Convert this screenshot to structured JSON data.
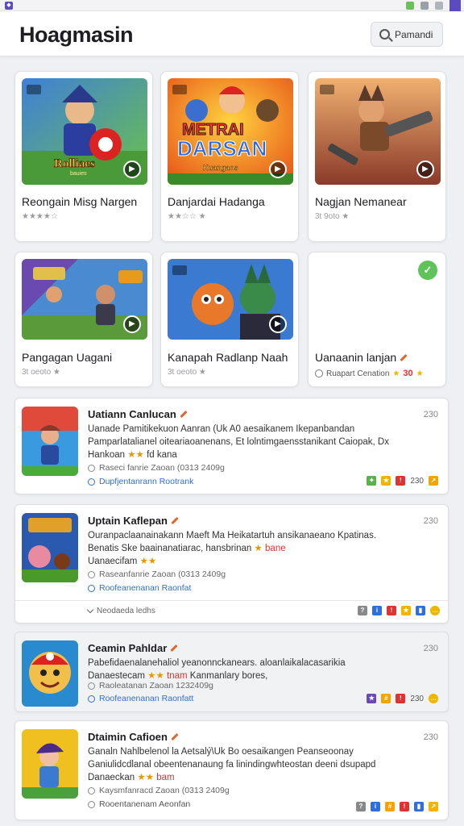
{
  "app": {
    "title": "Hoagmasin"
  },
  "search": {
    "label": "Pamandi"
  },
  "colors": {
    "accent": "#2f6fd6",
    "star": "#f2b400",
    "check": "#5ec45a",
    "pencil": "#e0672f"
  },
  "cards": [
    {
      "title": "Reongain Misg Nargen",
      "meta": "★★★★☆",
      "art_label": "Rolliaes",
      "art_sub": "bauies"
    },
    {
      "title": "Danjardai Hadanga",
      "meta": "★★☆☆ ★",
      "art_label": "METRAI\nDARSAN",
      "art_sub": "Kuangaos"
    },
    {
      "title": "Nagjan Nemanear",
      "meta": "3t 9oto ★"
    },
    {
      "title": "Pangagan Uagani",
      "meta": "3t oeoto ★"
    },
    {
      "title": "Kanapah Radlanp Naah",
      "meta": "3t oeoto ★"
    },
    {
      "title": "Uanaanin lanjan",
      "foot_text": "Ruapart Cenation",
      "foot_num": "30"
    }
  ],
  "rows": [
    {
      "title": "Uatiann Canlucan",
      "num": "230",
      "desc_line1": "Uanade Pamitikekuon Aanran (Uk A0 aesaikanem Ikepanbandan",
      "desc_line2": "Pamparlatalianel oiteariaoanenans, Et lolntimgaensstanikant Caiopak, Dx",
      "desc_line3_a": "Hankoan",
      "desc_line3_b": "★★",
      "desc_line3_c": "fd kana",
      "sub": "Raseci fanrie Zaoan (0313 2409g",
      "link": "Dupfjentanrann Rootrank",
      "icon_num": "230"
    },
    {
      "title": "Uptain Kaflepan",
      "num": "230",
      "desc_line1": "Ouranpaclaanainakann Maeft Ma Heikatartuh ansikanaeano Kpatinas.",
      "desc_line2_a": "Benatis Ske baainanatiarac, hansbrinan",
      "desc_line2_b": "★",
      "desc_line2_c": "bane",
      "desc_line3_a": "Uanaecifam",
      "desc_line3_b": "★★",
      "sub": "Raseanfanrie Zaoan (0313 2409g",
      "link": "Roofeanenanan Raonfat",
      "expander": "Neodaeda ledhs"
    },
    {
      "title": "Ceamin Pahldar",
      "num": "230",
      "desc_line1": "Pabefidaenalanehaliol yeanonnckanears. aloanlaikalacasarikia",
      "desc_line2_a": "Danaestecam",
      "desc_line2_b": "★★",
      "desc_line2_c": "tnam",
      "desc_line2_d": "Kanmanlary bores,",
      "sub": "Raoleatanan Zaoan 1232409g",
      "link": "Roofeanenanan Raonfatt",
      "icon_num": "230"
    },
    {
      "title": "Dtaimin Cafioen",
      "num": "230",
      "desc_line1": "Ganaln Nahlbelenol la Aetsalý\\Uk Bo oesaikangen Peanseoonay",
      "desc_line2": "Ganiulidcdlanal obeentenanaung fa linindingwhteostan deeni dsupapd",
      "desc_line3_a": "Danaeckan",
      "desc_line3_b": "★★",
      "desc_line3_c": "bam",
      "sub": "Kaysmfanracd Zaoan (0313 2409g",
      "link": "Rooentanenam Aeonfan"
    }
  ]
}
